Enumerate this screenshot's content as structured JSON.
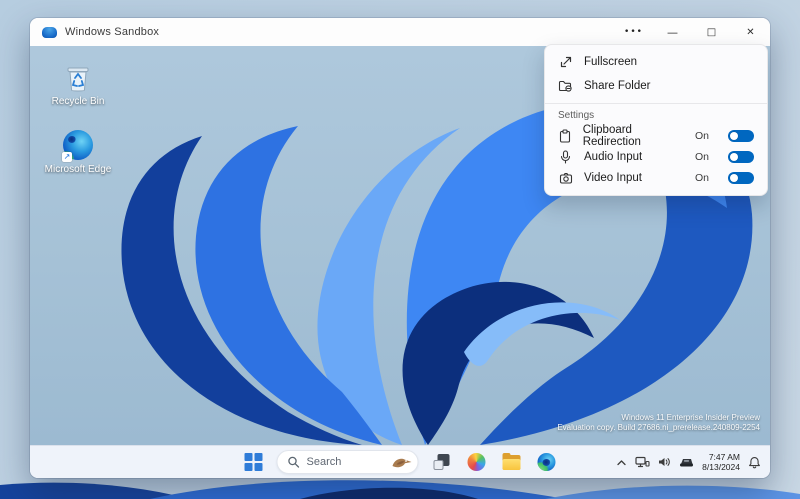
{
  "titlebar": {
    "title": "Windows Sandbox",
    "controls": {
      "menu": "•••",
      "minimize": "—",
      "maximize": "□",
      "close": "✕"
    }
  },
  "menu": {
    "actions": [
      {
        "label": "Fullscreen",
        "icon": "fullscreen-icon"
      },
      {
        "label": "Share Folder",
        "icon": "share-folder-icon"
      }
    ],
    "section_label": "Settings",
    "settings": [
      {
        "label": "Clipboard Redirection",
        "state": "On",
        "icon": "clipboard-icon"
      },
      {
        "label": "Audio Input",
        "state": "On",
        "icon": "microphone-icon"
      },
      {
        "label": "Video Input",
        "state": "On",
        "icon": "camera-icon"
      }
    ],
    "toggle_color": "#0067c0"
  },
  "desktop": {
    "icons": [
      {
        "label": "Recycle Bin",
        "icon": "recycle-bin-icon"
      },
      {
        "label": "Microsoft Edge",
        "icon": "edge-icon",
        "shortcut_arrow": "↗"
      }
    ],
    "watermark": {
      "line1": "Windows 11 Enterprise Insider Preview",
      "line2": "Evaluation copy. Build 27686.ni_prerelease.240809-2254"
    }
  },
  "taskbar": {
    "search_label": "Search",
    "tray": {
      "time": "7:47 AM",
      "date": "8/13/2024"
    }
  },
  "colors": {
    "accent": "#0067c0",
    "taskbar_bg": "#eff3fa",
    "host_background": "#bcd1e1",
    "wallpaper_light": "#aec8dc",
    "bloom_bright": "#3e87f3",
    "bloom_dark": "#123f9c"
  }
}
